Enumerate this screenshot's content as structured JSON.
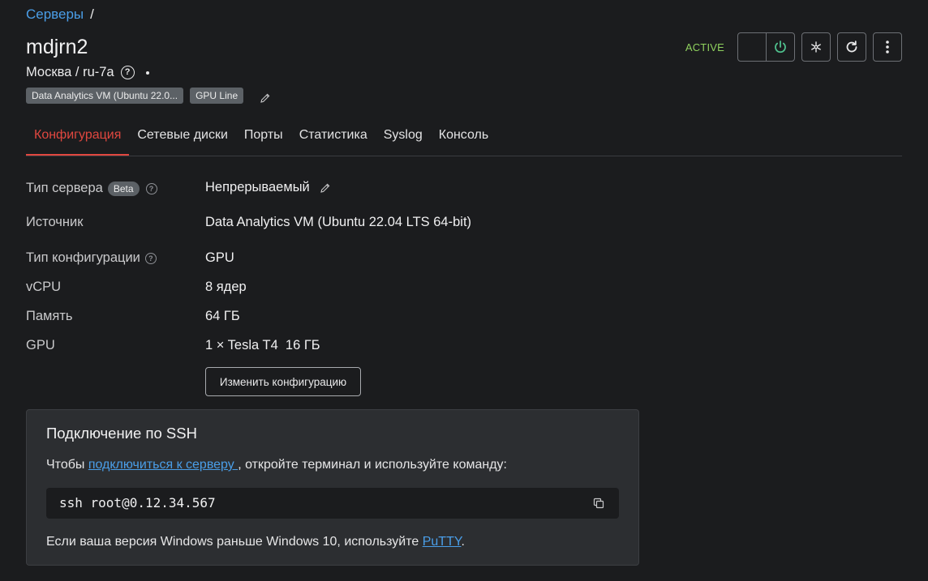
{
  "breadcrumb": {
    "root": "Серверы",
    "separator": "/"
  },
  "server": {
    "name": "mdjrn2",
    "location": "Москва / ru-7a",
    "tags": [
      "Data Analytics VM (Ubuntu 22.0...",
      "GPU Line"
    ]
  },
  "actions": {
    "status": "ACTIVE",
    "status_color": "#8fd15e",
    "icons": [
      "power-icon",
      "snowflake-icon",
      "reboot-icon",
      "more-vertical-icon"
    ]
  },
  "tabs": [
    {
      "label": "Конфигурация",
      "active": true
    },
    {
      "label": "Сетевые диски"
    },
    {
      "label": "Порты"
    },
    {
      "label": "Статистика"
    },
    {
      "label": "Syslog"
    },
    {
      "label": "Консоль"
    }
  ],
  "config": {
    "server_type_label": "Тип сервера",
    "beta_badge": "Beta",
    "server_type_value": "Непрерываемый",
    "source_label": "Источник",
    "source_value": "Data Analytics VM (Ubuntu 22.04 LTS 64-bit)",
    "config_type_label": "Тип конфигурации",
    "config_type_value": "GPU",
    "vcpu_label": "vCPU",
    "vcpu_value": "8 ядер",
    "memory_label": "Память",
    "memory_value": "64 ГБ",
    "gpu_label": "GPU",
    "gpu_value": "1 × Tesla T4  16 ГБ",
    "change_button": "Изменить конфигурацию"
  },
  "ssh": {
    "title": "Подключение по SSH",
    "desc_prefix": "Чтобы ",
    "desc_link": "подключиться к серверу ",
    "desc_suffix": ", откройте терминал и используйте команду:",
    "command": "ssh root@0.12.34.567",
    "note_prefix": "Если ваша версия Windows раньше Windows 10, используйте ",
    "note_link": "PuTTY",
    "note_suffix": "."
  },
  "colors": {
    "accent": "#e0473f",
    "link": "#4a9ee8",
    "background": "#1b1c1e"
  }
}
